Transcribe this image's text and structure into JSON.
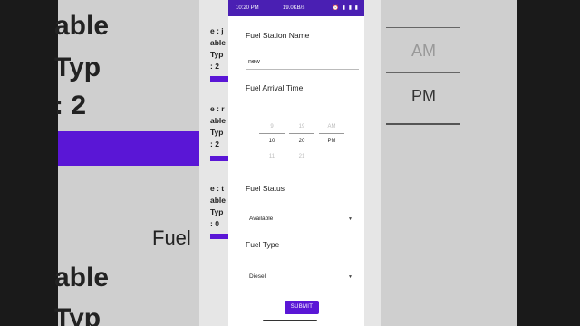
{
  "status_bar": {
    "time": "10:20 PM",
    "network_speed": "19.0KB/s",
    "icons": "⏰ ▮ ▮ ▮"
  },
  "form": {
    "station_name_label": "Fuel Station Name",
    "station_name_value": "new",
    "arrival_time_label": "Fuel Arrival Time",
    "time_picker": {
      "hours": {
        "prev": "9",
        "selected": "10",
        "next": "11"
      },
      "minutes": {
        "prev": "19",
        "selected": "20",
        "next": "21"
      },
      "ampm": {
        "prev": "AM",
        "selected": "PM",
        "next": ""
      }
    },
    "fuel_status_label": "Fuel Status",
    "fuel_status_value": "Available",
    "fuel_type_label": "Fuel Type",
    "fuel_type_value": "Diesel",
    "submit_label": "SUBMIT"
  },
  "background": {
    "left_fragments": [
      "able",
      "Typ",
      ": 2",
      "e : j",
      "able",
      "Typ",
      ": 2",
      "e : r",
      "able",
      "Typ",
      ": 2",
      "e : t",
      "able",
      "Typ",
      ": 0",
      "able",
      "Typ"
    ],
    "fuel_text": "Fuel",
    "ampm_am": "AM",
    "ampm_pm": "PM"
  }
}
